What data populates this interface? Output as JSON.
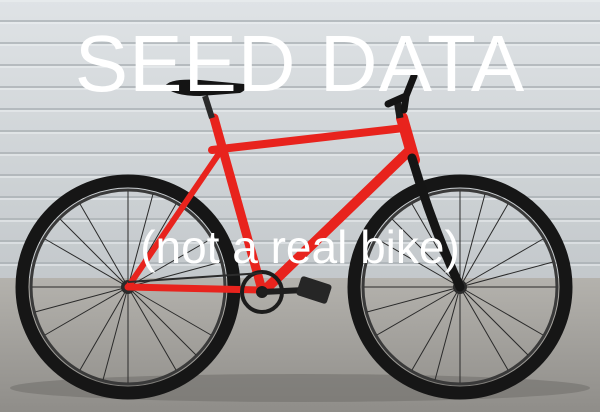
{
  "overlay": {
    "headline": "SEED DATA",
    "subline": "(not a real bike)"
  },
  "colors": {
    "wall": "#d5dadd",
    "ground": "#a9a7a2",
    "frame": "#e8231d",
    "tire": "#1b1b1b",
    "text": "#ffffff"
  },
  "photo": {
    "subject": "red fixed-gear bicycle",
    "background": "white siding wall",
    "surface": "concrete"
  }
}
